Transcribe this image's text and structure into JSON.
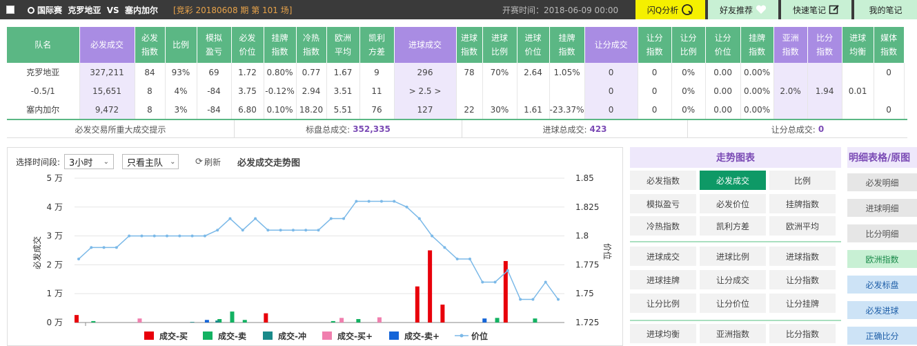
{
  "topbar": {
    "league": "国际赛",
    "home": "克罗地亚",
    "vs": "VS",
    "away": "塞内加尔",
    "issue": "[竞彩 20180608 期 第 101 场]",
    "start_time": "开赛时间：2018-06-09 00:00",
    "buttons": {
      "flash": "闪Q分析",
      "friend": "好友推荐",
      "note": "快速笔记",
      "mynote": "我的笔记"
    }
  },
  "table": {
    "headers": [
      "队名",
      "必发成交",
      "必发指数",
      "比例",
      "模拟盈亏",
      "必发价位",
      "挂牌指数",
      "冷热指数",
      "欧洲平均",
      "凯利方差",
      "进球成交",
      "进球指数",
      "进球比例",
      "进球价位",
      "挂牌指数",
      "让分成交",
      "让分指数",
      "让分比例",
      "让分价位",
      "挂牌指数",
      "亚洲指数",
      "比分指数",
      "进球均衡",
      "媒体指数"
    ],
    "rows": [
      [
        "克罗地亚",
        "327,211",
        "84",
        "93%",
        "69",
        "1.72",
        "0.80%",
        "0.77",
        "1.67",
        "9",
        "296",
        "78",
        "70%",
        "2.64",
        "1.05%",
        "0",
        "0",
        "0%",
        "0.00",
        "0.00%",
        "",
        "",
        "",
        "0"
      ],
      [
        "-0.5/1",
        "15,651",
        "8",
        "4%",
        "-84",
        "3.75",
        "-0.12%",
        "2.94",
        "3.51",
        "11",
        "> 2.5 >",
        "",
        "",
        "",
        "",
        "0",
        "0",
        "0%",
        "0.00",
        "0.00%",
        "2.0%",
        "1.94",
        "0.01",
        ""
      ],
      [
        "塞内加尔",
        "9,472",
        "8",
        "3%",
        "-84",
        "6.80",
        "0.10%",
        "18.20",
        "5.51",
        "76",
        "127",
        "22",
        "30%",
        "1.61",
        "-23.37%",
        "0",
        "0",
        "0%",
        "0.00",
        "0.00%",
        "",
        "",
        "",
        "0"
      ]
    ]
  },
  "summary": {
    "tip": "必发交易所重大成交提示",
    "biaopan_label": "标盘总成交:",
    "biaopan_value": "352,335",
    "jinqiu_label": "进球总成交:",
    "jinqiu_value": "423",
    "rangfen_label": "让分总成交:",
    "rangfen_value": "0"
  },
  "chart_controls": {
    "period_label": "选择时间段:",
    "period_value": "3小时",
    "team_value": "只看主队",
    "refresh": "刷新",
    "title": "必发成交走势图"
  },
  "chart_data": {
    "type": "bar+line",
    "ylabel_left": "必发成交",
    "ylabel_right": "价位",
    "left_ticks": [
      "0 万",
      "1 万",
      "2 万",
      "3 万",
      "4 万",
      "5 万"
    ],
    "left_ylim": [
      0,
      50000
    ],
    "right_ticks": [
      "1.725",
      "1.75",
      "1.775",
      "1.8",
      "1.825",
      "1.85"
    ],
    "right_ylim": [
      1.725,
      1.85
    ],
    "legend": [
      "成交-买",
      "成交-卖",
      "成交-冲",
      "成交-买+",
      "成交-卖+",
      "价位"
    ],
    "colors": {
      "buy": "#e8000b",
      "sell": "#13b262",
      "hedge": "#1a8a8a",
      "buy_plus": "#f07fae",
      "sell_plus": "#1565d8",
      "price": "#7bb9e8"
    },
    "bars": [
      {
        "i": 0,
        "series": "成交-买",
        "value": 2600
      },
      {
        "i": 1,
        "series": "成交-卖",
        "value": 500
      },
      {
        "i": 5,
        "series": "成交-买+",
        "value": 1400
      },
      {
        "i": 9,
        "series": "成交-冲",
        "value": 200
      },
      {
        "i": 10,
        "series": "成交-卖+",
        "value": 900
      },
      {
        "i": 11,
        "series": "成交-卖",
        "value": 1200
      },
      {
        "i": 11,
        "series": "成交-冲",
        "value": 700
      },
      {
        "i": 12,
        "series": "成交-卖",
        "value": 3800
      },
      {
        "i": 13,
        "series": "成交-卖",
        "value": 900
      },
      {
        "i": 15,
        "series": "成交-买",
        "value": 3200
      },
      {
        "i": 20,
        "series": "成交-卖",
        "value": 500
      },
      {
        "i": 21,
        "series": "成交-买+",
        "value": 1600
      },
      {
        "i": 22,
        "series": "成交-卖",
        "value": 1200
      },
      {
        "i": 24,
        "series": "成交-买+",
        "value": 1800
      },
      {
        "i": 27,
        "series": "成交-买",
        "value": 12500
      },
      {
        "i": 28,
        "series": "成交-买",
        "value": 25000
      },
      {
        "i": 29,
        "series": "成交-买",
        "value": 6200
      },
      {
        "i": 32,
        "series": "成交-卖+",
        "value": 1400
      },
      {
        "i": 33,
        "series": "成交-卖",
        "value": 1600
      },
      {
        "i": 34,
        "series": "成交-买",
        "value": 21300
      },
      {
        "i": 36,
        "series": "成交-卖",
        "value": 1400
      }
    ],
    "price": [
      1.78,
      1.79,
      1.79,
      1.79,
      1.8,
      1.8,
      1.8,
      1.8,
      1.8,
      1.8,
      1.8,
      1.805,
      1.815,
      1.805,
      1.815,
      1.805,
      1.805,
      1.805,
      1.805,
      1.805,
      1.815,
      1.815,
      1.83,
      1.83,
      1.83,
      1.83,
      1.825,
      1.815,
      1.8,
      1.79,
      1.78,
      1.78,
      1.76,
      1.76,
      1.77,
      1.745,
      1.745,
      1.76,
      1.745
    ]
  },
  "trend": {
    "title": "走势图表",
    "buttons": [
      "必发指数",
      "必发成交",
      "比例",
      "模拟盈亏",
      "必发价位",
      "挂牌指数",
      "冷热指数",
      "凯利方差",
      "欧洲平均",
      "进球成交",
      "进球比例",
      "进球指数",
      "进球挂牌",
      "让分成交",
      "让分指数",
      "让分比例",
      "让分价位",
      "让分挂牌",
      "进球均衡",
      "亚洲指数",
      "比分指数"
    ]
  },
  "detail": {
    "title": "明细表格/原图",
    "buttons": [
      "必发明细",
      "进球明细",
      "比分明细",
      "欧洲指数",
      "必发标盘",
      "必发进球",
      "正确比分"
    ]
  }
}
